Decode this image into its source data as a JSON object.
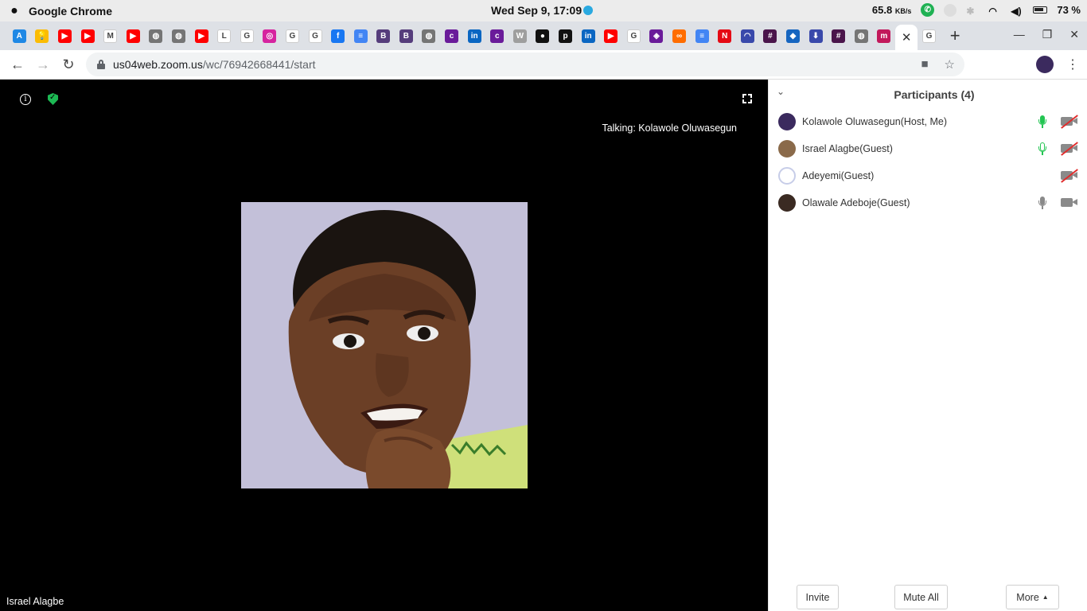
{
  "menubar": {
    "app_name": "Google Chrome",
    "clock": "Wed Sep  9, 17:09",
    "net_speed": "65.8",
    "net_unit": "KB/s",
    "battery": "73 %"
  },
  "tabs": {
    "favicons": [
      {
        "icon": "app-store-icon",
        "color": "#1e88e5",
        "glyph": "A"
      },
      {
        "icon": "keep-icon",
        "color": "#fbbc04",
        "glyph": "💡"
      },
      {
        "icon": "youtube-icon",
        "color": "#ff0000",
        "glyph": "▶"
      },
      {
        "icon": "youtube-icon",
        "color": "#ff0000",
        "glyph": "▶"
      },
      {
        "icon": "gmail-icon",
        "color": "#ffffff",
        "glyph": "M"
      },
      {
        "icon": "youtube-icon",
        "color": "#ff0000",
        "glyph": "▶"
      },
      {
        "icon": "globe-icon",
        "color": "#757575",
        "glyph": "◍"
      },
      {
        "icon": "globe-icon",
        "color": "#757575",
        "glyph": "◍"
      },
      {
        "icon": "youtube-icon",
        "color": "#ff0000",
        "glyph": "▶"
      },
      {
        "icon": "l-icon",
        "color": "#ffffff",
        "glyph": "L"
      },
      {
        "icon": "google-icon",
        "color": "#ffffff",
        "glyph": "G"
      },
      {
        "icon": "instagram-icon",
        "color": "#d6249f",
        "glyph": "◎"
      },
      {
        "icon": "google-icon",
        "color": "#ffffff",
        "glyph": "G"
      },
      {
        "icon": "google-icon",
        "color": "#ffffff",
        "glyph": "G"
      },
      {
        "icon": "facebook-icon",
        "color": "#1877f2",
        "glyph": "f"
      },
      {
        "icon": "docs-icon",
        "color": "#4285f4",
        "glyph": "≡"
      },
      {
        "icon": "bootstrap-icon",
        "color": "#563d7c",
        "glyph": "B"
      },
      {
        "icon": "bootstrap-icon",
        "color": "#563d7c",
        "glyph": "B"
      },
      {
        "icon": "globe-icon",
        "color": "#757575",
        "glyph": "◍"
      },
      {
        "icon": "colorlib-icon",
        "color": "#6a1b9a",
        "glyph": "c"
      },
      {
        "icon": "linkedin-icon",
        "color": "#0a66c2",
        "glyph": "in"
      },
      {
        "icon": "colorlib-icon",
        "color": "#6a1b9a",
        "glyph": "c"
      },
      {
        "icon": "wordpress-icon",
        "color": "#9e9e9e",
        "glyph": "W"
      },
      {
        "icon": "circle-icon",
        "color": "#111111",
        "glyph": "●"
      },
      {
        "icon": "p-icon",
        "color": "#111111",
        "glyph": "p"
      },
      {
        "icon": "linkedin-icon",
        "color": "#0a66c2",
        "glyph": "in"
      },
      {
        "icon": "youtube-icon",
        "color": "#ff0000",
        "glyph": "▶"
      },
      {
        "icon": "google-icon",
        "color": "#ffffff",
        "glyph": "G"
      },
      {
        "icon": "stack-icon",
        "color": "#6a1b9a",
        "glyph": "◈"
      },
      {
        "icon": "link-icon",
        "color": "#ff6d00",
        "glyph": "∞"
      },
      {
        "icon": "docs-icon",
        "color": "#4285f4",
        "glyph": "≡"
      },
      {
        "icon": "netflix-icon",
        "color": "#e50914",
        "glyph": "N"
      },
      {
        "icon": "swirl-icon",
        "color": "#3949ab",
        "glyph": "◠"
      },
      {
        "icon": "slack-icon",
        "color": "#4a154b",
        "glyph": "#"
      },
      {
        "icon": "box-icon",
        "color": "#1565c0",
        "glyph": "◆"
      },
      {
        "icon": "download-icon",
        "color": "#3949ab",
        "glyph": "⬇"
      },
      {
        "icon": "slack-icon",
        "color": "#4a154b",
        "glyph": "#"
      },
      {
        "icon": "globe-icon",
        "color": "#757575",
        "glyph": "◍"
      },
      {
        "icon": "medium-icon",
        "color": "#c2185b",
        "glyph": "m"
      }
    ],
    "active_tab_close": "✕",
    "after_active": {
      "icon": "google-icon",
      "color": "#ffffff",
      "glyph": "G"
    },
    "new_tab": "+"
  },
  "address_bar": {
    "host": "us04web.zoom.us",
    "path": "/wc/76942668441/start"
  },
  "meeting": {
    "talking": "Talking: Kolawole Oluwasegun",
    "active_speaker_name": "Israel Alagbe",
    "info_glyph": "i"
  },
  "participants": {
    "title": "Participants (4)",
    "list": [
      {
        "name": "Kolawole Oluwasegun(Host, Me)",
        "mic": "on-active",
        "video": "off",
        "avatar_color": "#3b2a5e"
      },
      {
        "name": "Israel Alagbe(Guest)",
        "mic": "on",
        "video": "off",
        "avatar_color": "#8a6a4a"
      },
      {
        "name": "Adeyemi(Guest)",
        "mic": "none",
        "video": "off",
        "avatar_color": "#c7cde8"
      },
      {
        "name": "Olawale Adeboje(Guest)",
        "mic": "muted-grey",
        "video": "on",
        "avatar_color": "#3a2a22"
      }
    ],
    "actions": {
      "invite": "Invite",
      "mute_all": "Mute All",
      "more": "More"
    }
  },
  "colors": {
    "mic_active": "#23c552",
    "mic_idle": "#8a8a8a",
    "video_slash": "#e02c2c"
  }
}
